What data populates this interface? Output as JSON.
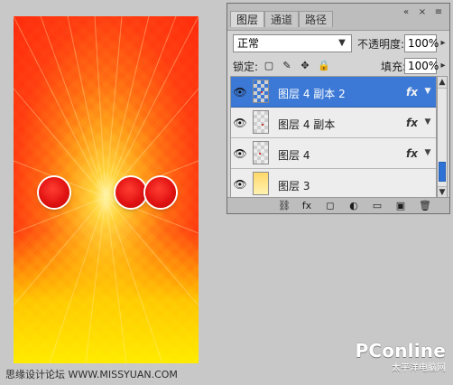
{
  "panel": {
    "tabs": [
      {
        "label": "图层",
        "active": true
      },
      {
        "label": "通道",
        "active": false
      },
      {
        "label": "路径",
        "active": false
      }
    ],
    "top_icons": [
      {
        "name": "collapse-icon",
        "glyph": "«"
      },
      {
        "name": "close-icon",
        "glyph": "×"
      },
      {
        "name": "panel-menu-icon",
        "glyph": "≡"
      }
    ],
    "blend_mode": "正常",
    "opacity_label": "不透明度:",
    "opacity_value": "100%",
    "lock_label": "锁定:",
    "fill_label": "填充:",
    "fill_value": "100%",
    "layers": [
      {
        "name": "图层 4 副本 2",
        "selected": true,
        "has_fx": true
      },
      {
        "name": "图层 4 副本",
        "selected": false,
        "has_fx": true
      },
      {
        "name": "图层 4",
        "selected": false,
        "has_fx": true
      },
      {
        "name": "图层 3",
        "selected": false,
        "has_fx": false
      }
    ],
    "bottom_icons": [
      {
        "name": "link-layers-icon",
        "glyph": "⛓"
      },
      {
        "name": "add-layer-style-icon",
        "glyph": "fx"
      },
      {
        "name": "add-mask-icon",
        "glyph": "◻"
      },
      {
        "name": "adjustment-layer-icon",
        "glyph": "◐"
      },
      {
        "name": "new-group-icon",
        "glyph": "▭"
      },
      {
        "name": "new-layer-icon",
        "glyph": "▣"
      },
      {
        "name": "trash-icon",
        "glyph": "🗑"
      }
    ]
  },
  "watermarks": {
    "left_text": "思缘设计论坛 WWW.MISSYUAN.COM",
    "brand": "PConline",
    "brand_sub": "太平洋电脑网"
  },
  "colors": {
    "panel_bg": "#d4d4d4",
    "selected_layer": "#3c79d6",
    "canvas_red": "#ff2a0c",
    "canvas_yellow": "#ffeb00"
  }
}
